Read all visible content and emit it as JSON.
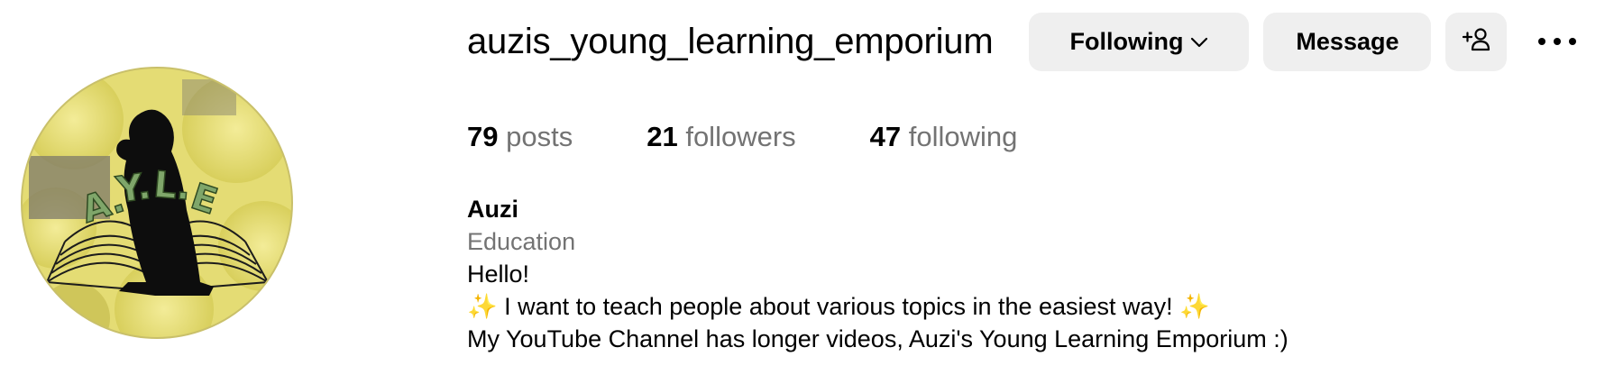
{
  "profile": {
    "username": "auzis_young_learning_emporium",
    "display_name": "Auzi",
    "category": "Education",
    "avatar_logo_text": "A.Y.L.E"
  },
  "actions": {
    "following_label": "Following",
    "message_label": "Message"
  },
  "stats": {
    "posts_count": "79",
    "posts_label": "posts",
    "followers_count": "21",
    "followers_label": "followers",
    "following_count": "47",
    "following_label": "following"
  },
  "bio": {
    "line1": "Hello!",
    "line2_sparkle": "✨",
    "line2_text": " I want to teach people about various topics in the easiest way! ",
    "line3": "My YouTube Channel has longer videos, Auzi's Young Learning Emporium :)"
  },
  "icons": {
    "following": "chevron-down-icon",
    "add_user": "add-user-icon",
    "more": "more-icon",
    "sparkle": "sparkle-icon"
  },
  "colors": {
    "button_bg": "#efefef",
    "secondary_text": "#737373",
    "avatar_yellow": "#e6df7a",
    "logo_green": "#7fa66a"
  }
}
